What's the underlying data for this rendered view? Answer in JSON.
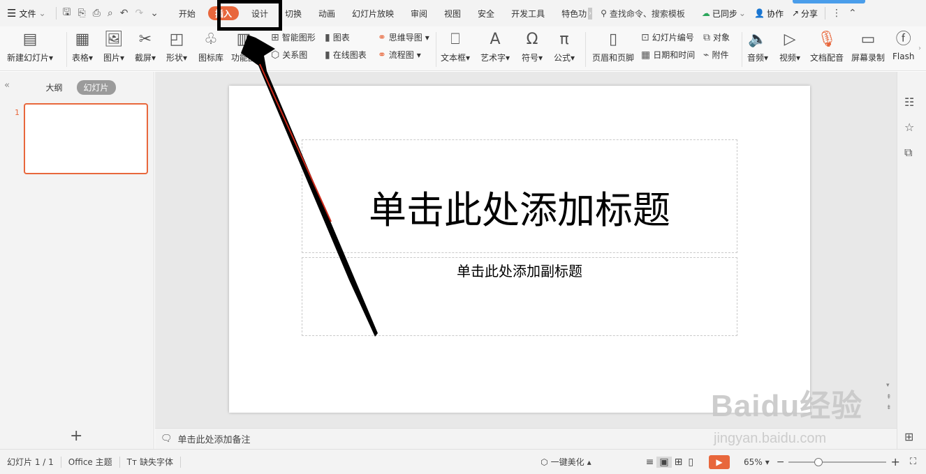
{
  "topbar": {
    "file_menu": "文件",
    "tabs": [
      "开始",
      "插入",
      "设计",
      "切换",
      "动画",
      "幻灯片放映",
      "审阅",
      "视图",
      "安全",
      "开发工具",
      "特色功"
    ],
    "search_placeholder": "查找命令、搜索模板",
    "sync": "已同步",
    "collaborate": "协作",
    "share": "分享"
  },
  "ribbon": {
    "new_slide": "新建幻灯片",
    "table": "表格",
    "picture": "图片",
    "screenshot": "截屏",
    "shape": "形状",
    "icon_library": "图标库",
    "function_chart": "功能图",
    "smart_art": "智能图形",
    "chart": "图表",
    "mind_map": "思维导图",
    "relation": "关系图",
    "online_chart": "在线图表",
    "flowchart": "流程图",
    "textbox": "文本框",
    "wordart": "艺术字",
    "symbol": "符号",
    "formula": "公式",
    "header_footer": "页眉和页脚",
    "slide_number": "幻灯片编号",
    "object": "对象",
    "datetime": "日期和时间",
    "attachment": "附件",
    "audio": "音频",
    "video": "视频",
    "text_voice": "文档配音",
    "screen_record": "屏幕录制",
    "flash": "Flash"
  },
  "leftpanel": {
    "outline_tab": "大纲",
    "slides_tab": "幻灯片",
    "slide_number": "1"
  },
  "slide": {
    "title_placeholder": "单击此处添加标题",
    "subtitle_placeholder": "单击此处添加副标题"
  },
  "notes": {
    "placeholder": "单击此处添加备注"
  },
  "status": {
    "slide_count": "幻灯片 1 / 1",
    "theme": "Office 主题",
    "missing_fonts": "缺失字体",
    "beautify": "一键美化",
    "zoom": "65%"
  },
  "watermark": {
    "brand": "Baidu经验",
    "url": "jingyan.baidu.com"
  },
  "colors": {
    "accent": "#e8673c",
    "cloud": "#4a9dea"
  }
}
